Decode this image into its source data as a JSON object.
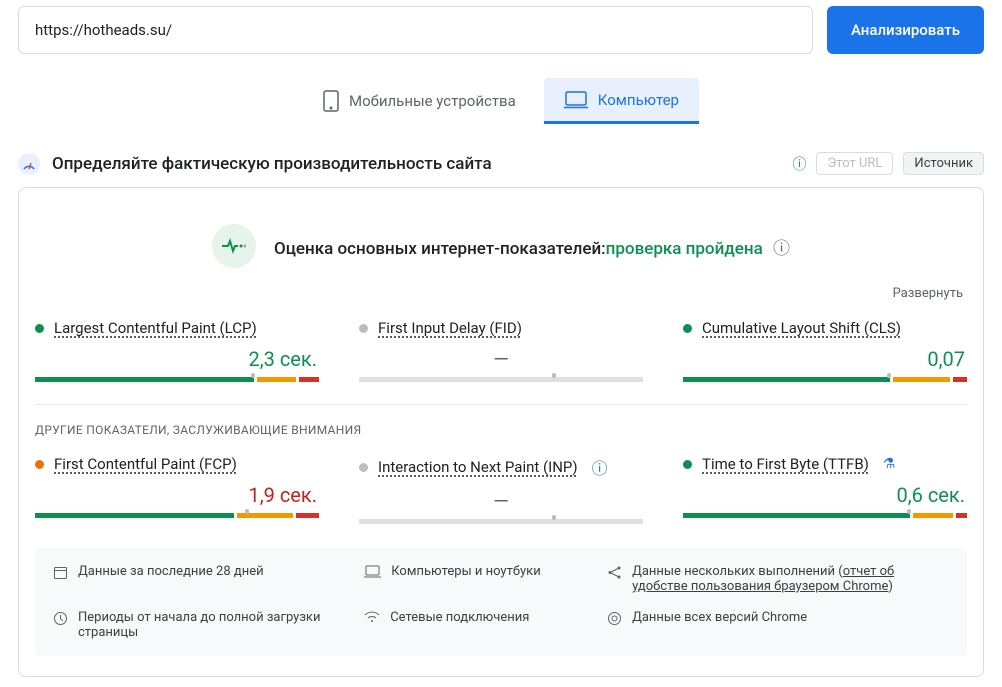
{
  "input": {
    "value": "https://hotheads.su/"
  },
  "analyzeBtn": "Анализировать",
  "tabs": {
    "mobile": "Мобильные устройства",
    "desktop": "Компьютер"
  },
  "sectionTitle": "Определяйте фактическую производительность сайта",
  "pills": {
    "url": "Этот URL",
    "origin": "Источник"
  },
  "assess": {
    "label": "Оценка основных интернет-показателей:",
    "status": "проверка пройдена"
  },
  "expand": "Развернуть",
  "metrics": {
    "lcp": {
      "name": "Largest Contentful Paint (LCP)",
      "value": "2,3 сек."
    },
    "fid": {
      "name": "First Input Delay (FID)",
      "value": "—"
    },
    "cls": {
      "name": "Cumulative Layout Shift (CLS)",
      "value": "0,07"
    },
    "fcp": {
      "name": "First Contentful Paint (FCP)",
      "value": "1,9 сек."
    },
    "inp": {
      "name": "Interaction to Next Paint (INP)",
      "value": "—"
    },
    "ttfb": {
      "name": "Time to First Byte (TTFB)",
      "value": "0,6 сек."
    }
  },
  "otherH": "ДРУГИЕ ПОКАЗАТЕЛИ, ЗАСЛУЖИВАЮЩИЕ ВНИМАНИЯ",
  "footer": {
    "f1": "Данные за последние 28 дней",
    "f2": "Компьютеры и ноутбуки",
    "f3a": "Данные нескольких выполнений (",
    "f3link": "отчет об удобстве пользования браузером Chrome",
    "f3b": ")",
    "f4": "Периоды от начала до полной загрузки страницы",
    "f5": "Сетевые подключения",
    "f6": "Данные всех версий Chrome"
  }
}
